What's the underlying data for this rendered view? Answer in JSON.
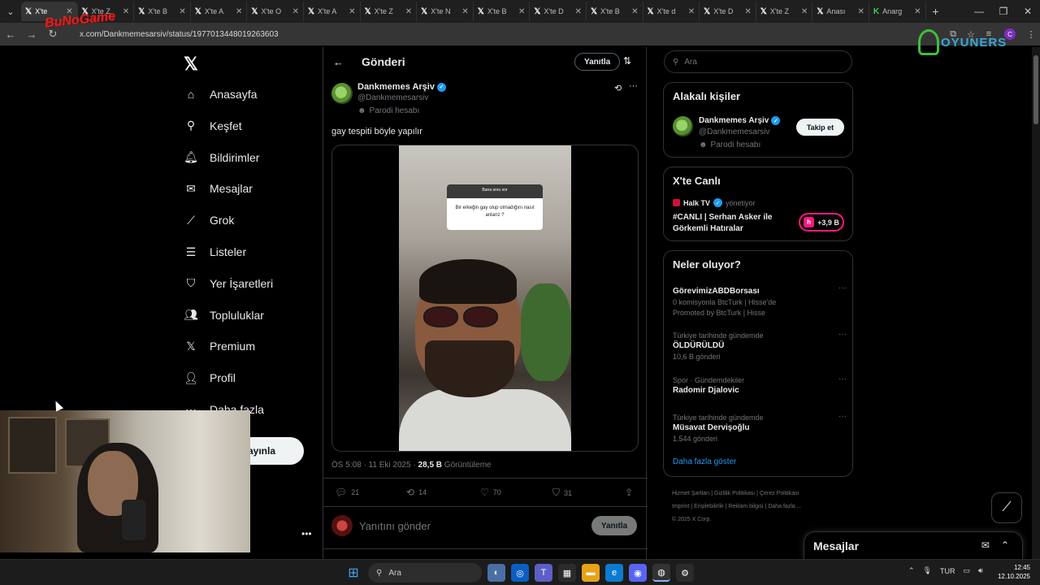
{
  "browser": {
    "tabs": [
      {
        "label": "X'te",
        "active": true
      },
      {
        "label": "X'te Z"
      },
      {
        "label": "X'te B"
      },
      {
        "label": "X'te A"
      },
      {
        "label": "X'te O"
      },
      {
        "label": "X'te A"
      },
      {
        "label": "X'te Z"
      },
      {
        "label": "X'te N"
      },
      {
        "label": "X'te B"
      },
      {
        "label": "X'te D"
      },
      {
        "label": "X'te B"
      },
      {
        "label": "X'te d"
      },
      {
        "label": "X'te D"
      },
      {
        "label": "X'te Z"
      },
      {
        "label": "Anası"
      },
      {
        "label": "Anarg"
      }
    ],
    "url": "x.com/Dankmemesarsiv/status/1977013448019263603",
    "profile_initial": "C"
  },
  "overlay": {
    "left_logo": "BuNoGame",
    "right_logo": "OYUNERS"
  },
  "nav": {
    "items": [
      {
        "label": "Anasayfa",
        "icon": "home-icon"
      },
      {
        "label": "Keşfet",
        "icon": "search-icon"
      },
      {
        "label": "Bildirimler",
        "icon": "bell-icon"
      },
      {
        "label": "Mesajlar",
        "icon": "mail-icon"
      },
      {
        "label": "Grok",
        "icon": "grok-icon"
      },
      {
        "label": "Listeler",
        "icon": "list-icon"
      },
      {
        "label": "Yer İşaretleri",
        "icon": "bookmark-icon"
      },
      {
        "label": "Topluluklar",
        "icon": "communities-icon"
      },
      {
        "label": "Premium",
        "icon": "x-premium-icon"
      },
      {
        "label": "Profil",
        "icon": "profile-icon"
      },
      {
        "label": "Daha fazla",
        "icon": "more-icon"
      }
    ],
    "post_button": "ayınla"
  },
  "post": {
    "header_title": "Gönderi",
    "header_reply": "Yanıtla",
    "author_name": "Dankmemes Arşiv",
    "author_handle": "@Dankmemesarsiv",
    "parody_label": "Parodi hesabı",
    "text": "gay tespiti böyle yapılır",
    "video_question_header": "Bana soru sor",
    "video_question": "Bir erkeğin gay olup olmadığını nasıl anlarız ?",
    "meta_time": "ÖS 5:08 · 11 Eki 2025 · ",
    "views_count": "28,5 B",
    "views_label": " Görüntüleme",
    "stats": {
      "replies": "21",
      "reposts": "14",
      "likes": "70",
      "bookmarks": "31"
    },
    "reply_placeholder": "Yanıtını gönder",
    "reply_button": "Yanıtla"
  },
  "sidebar": {
    "search_placeholder": "Ara",
    "relevant_title": "Alakalı kişiler",
    "relevant": {
      "name": "Dankmemes Arşiv",
      "handle": "@Dankmemesarsiv",
      "parody": "Parodi hesabı",
      "follow": "Takip et"
    },
    "live_title": "X'te Canlı",
    "live": {
      "host": "Halk TV",
      "role": "yönetiyor",
      "title": "#CANLI | Serhan Asker ile Görkemli Hatıralar",
      "count": "+3,9 B"
    },
    "trends_title": "Neler oluyor?",
    "trends": [
      {
        "context": "",
        "name": "GörevimizABDBorsası",
        "sub": "0 komisyonla BtcTurk | Hisse'de",
        "promo": "Promoted by BtcTurk | Hisse"
      },
      {
        "context": "Türkiye tarihinde gündemde",
        "name": "ÖLDÜRÜLDÜ",
        "sub": "10,6 B gönderi",
        "promo": ""
      },
      {
        "context": "Spor · Gündemdekiler",
        "name": "Radomir Djalovic",
        "sub": "",
        "promo": ""
      },
      {
        "context": "Türkiye tarihinde gündemde",
        "name": "Müsavat Dervişoğlu",
        "sub": "1.544 gönderi",
        "promo": ""
      }
    ],
    "show_more": "Daha fazla göster",
    "footer": [
      "Hizmet Şartları",
      "Gizlilik Politikası",
      "Çerez Politikası",
      "Imprint",
      "Erişilebilirlik",
      "Reklam bilgisi",
      "Daha fazla ...",
      "© 2025 X Corp."
    ]
  },
  "messages_drawer": {
    "title": "Mesajlar"
  },
  "taskbar": {
    "search": "Ara",
    "lang": "TUR",
    "time": "12:45",
    "date": "12.10.2025"
  },
  "colors": {
    "accent": "#1d9bf0",
    "live": "#f91880",
    "background": "#000000"
  }
}
